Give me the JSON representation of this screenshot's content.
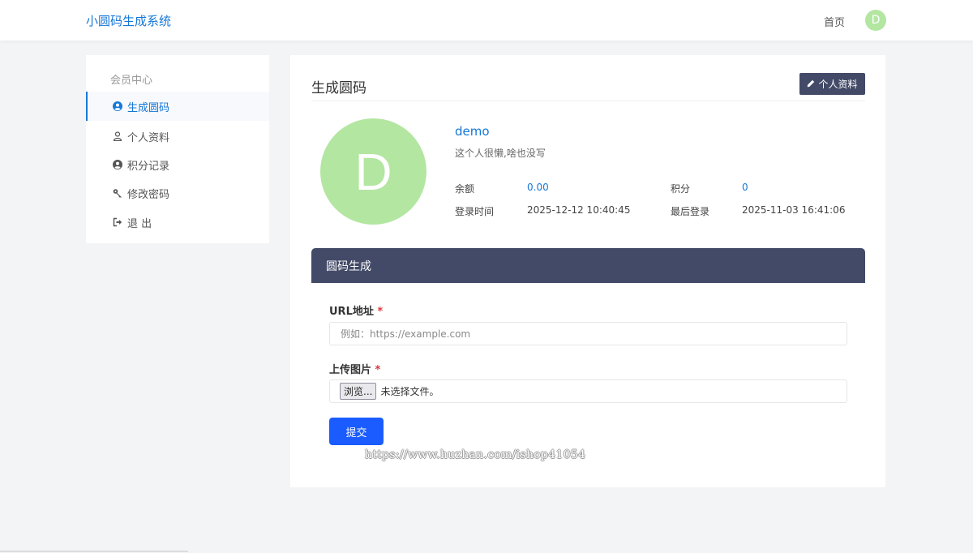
{
  "header": {
    "brand": "小圆码生成系统",
    "home_label": "首页",
    "avatar_letter": "D"
  },
  "sidebar": {
    "heading": "会员中心",
    "items": [
      {
        "label": "生成圆码",
        "icon": "user-circle-icon",
        "active": true
      },
      {
        "label": "个人资料",
        "icon": "user-icon",
        "active": false
      },
      {
        "label": "积分记录",
        "icon": "user-circle-icon",
        "active": false
      },
      {
        "label": "修改密码",
        "icon": "key-icon",
        "active": false
      },
      {
        "label": "退 出",
        "icon": "sign-out-icon",
        "active": false
      }
    ]
  },
  "main": {
    "title": "生成圆码",
    "edit_profile_label": "个人资料",
    "profile": {
      "avatar_letter": "D",
      "username": "demo",
      "bio": "这个人很懒,啥也没写",
      "balance_label": "余额",
      "balance_value": "0.00",
      "points_label": "积分",
      "points_value": "0",
      "login_time_label": "登录时间",
      "login_time_value": "2025-12-12 10:40:45",
      "last_login_label": "最后登录",
      "last_login_value": "2025-11-03 16:41:06"
    },
    "generator": {
      "header": "圆码生成",
      "url_label": "URL地址",
      "url_placeholder": "例如：https://example.com",
      "url_value": "",
      "upload_label": "上传图片",
      "required_mark": "*",
      "file_button_label": "浏览...",
      "file_status": "未选择文件。",
      "submit_label": "提交"
    }
  },
  "watermark": "https://www.huzhan.com/ishop41054",
  "colors": {
    "accent": "#1677d6",
    "dark_header": "#434a67",
    "submit": "#1a5cff",
    "avatar": "#b3e6a1",
    "required": "#d9363e"
  }
}
